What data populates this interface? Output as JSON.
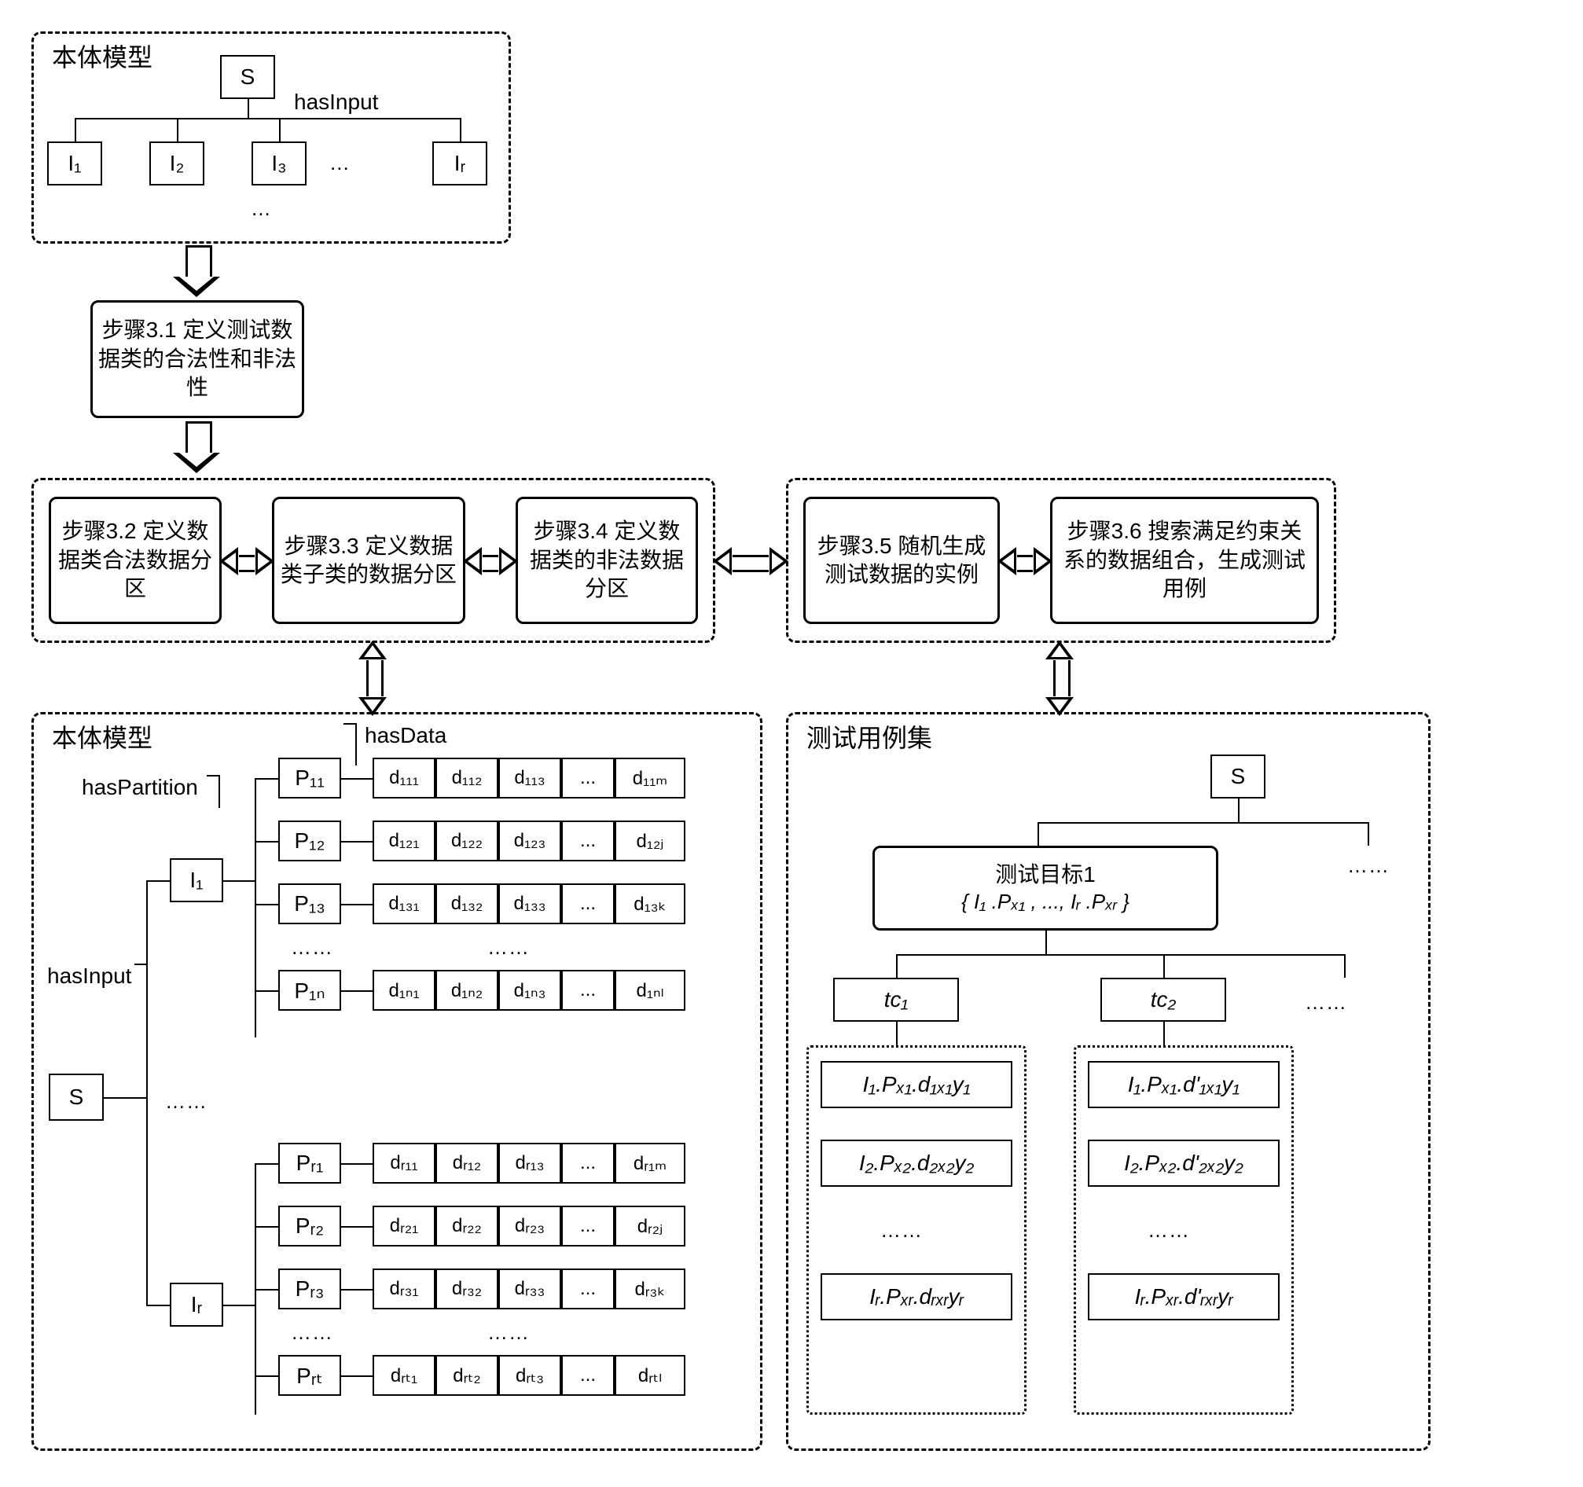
{
  "top_ontology": {
    "title": "本体模型",
    "root": "S",
    "hasInput": "hasInput",
    "children": [
      "I₁",
      "I₂",
      "I₃",
      "...",
      "Iᵣ"
    ],
    "bottom_ellipsis": "..."
  },
  "steps": {
    "s31": "步骤3.1 定义测试数据类的合法性和非法性",
    "s32": "步骤3.2 定义数据类合法数据分区",
    "s33": "步骤3.3 定义数据类子类的数据分区",
    "s34": "步骤3.4 定义数据类的非法数据分区",
    "s35": "步骤3.5 随机生成测试数据的实例",
    "s36": "步骤3.6 搜索满足约束关系的数据组合，生成测试用例"
  },
  "bottom_ontology": {
    "title": "本体模型",
    "root": "S",
    "hasInput": "hasInput",
    "inputs": [
      "I₁",
      "Iᵣ"
    ],
    "mid_ellipsis": "……",
    "hasPartition": "hasPartition",
    "hasData": "hasData",
    "partitions_I1": [
      "P₁₁",
      "P₁₂",
      "P₁₃",
      "P₁ₙ"
    ],
    "p_ellipsis_I1": "……",
    "partitions_Ir": [
      "Pᵣ₁",
      "Pᵣ₂",
      "Pᵣ₃",
      "Pᵣₜ"
    ],
    "p_ellipsis_Ir": "……",
    "rows": {
      "p11": [
        "d₁₁₁",
        "d₁₁₂",
        "d₁₁₃",
        "...",
        "d₁₁ₘ"
      ],
      "p12": [
        "d₁₂₁",
        "d₁₂₂",
        "d₁₂₃",
        "...",
        "d₁₂ⱼ"
      ],
      "p13": [
        "d₁₃₁",
        "d₁₃₂",
        "d₁₃₃",
        "...",
        "d₁₃ₖ"
      ],
      "p13_ell": "……",
      "p1n": [
        "d₁ₙ₁",
        "d₁ₙ₂",
        "d₁ₙ₃",
        "...",
        "d₁ₙₗ"
      ],
      "pr1": [
        "dᵣ₁₁",
        "dᵣ₁₂",
        "dᵣ₁₃",
        "...",
        "dᵣ₁ₘ"
      ],
      "pr2": [
        "dᵣ₂₁",
        "dᵣ₂₂",
        "dᵣ₂₃",
        "...",
        "dᵣ₂ⱼ"
      ],
      "pr3": [
        "dᵣ₃₁",
        "dᵣ₃₂",
        "dᵣ₃₃",
        "...",
        "dᵣ₃ₖ"
      ],
      "pr3_ell": "……",
      "prt": [
        "dᵣₜ₁",
        "dᵣₜ₂",
        "dᵣₜ₃",
        "...",
        "dᵣₜₗ"
      ]
    }
  },
  "testcases": {
    "title": "测试用例集",
    "root": "S",
    "target_title": "测试目标1",
    "target_set": "{ I₁ .Pₓ₁ , ..., Iᵣ .Pₓᵣ }",
    "top_ellipsis": "……",
    "tc1": "tc₁",
    "tc2": "tc₂",
    "tc_ellipsis": "……",
    "group1": [
      "I₁.Pₓ₁.d₁ₓ₁y₁",
      "I₂.Pₓ₂.d₂ₓ₂y₂",
      "……",
      "Iᵣ.Pₓᵣ.dᵣₓᵣyᵣ"
    ],
    "group2": [
      "I₁.Pₓ₁.d'₁ₓ₁y₁",
      "I₂.Pₓ₂.d'₂ₓ₂y₂",
      "……",
      "Iᵣ.Pₓᵣ.d'ᵣₓᵣyᵣ"
    ]
  },
  "chart_data": {
    "type": "flow_diagram",
    "title": "Ontology-driven test data partitioning and test case generation",
    "nodes": [
      {
        "id": "ontology_top",
        "label": "本体模型",
        "children": [
          "S"
        ],
        "S_children": [
          "I₁",
          "I₂",
          "I₃",
          "...",
          "Iᵣ"
        ],
        "edge_label": "hasInput"
      },
      {
        "id": "step31",
        "label": "步骤3.1 定义测试数据类的合法性和非法性"
      },
      {
        "id": "step32",
        "label": "步骤3.2 定义数据类合法数据分区"
      },
      {
        "id": "step33",
        "label": "步骤3.3 定义数据类子类的数据分区"
      },
      {
        "id": "step34",
        "label": "步骤3.4 定义数据类的非法数据分区"
      },
      {
        "id": "step35",
        "label": "步骤3.5 随机生成测试数据的实例"
      },
      {
        "id": "step36",
        "label": "步骤3.6 搜索满足约束关系的数据组合，生成测试用例"
      },
      {
        "id": "ontology_bottom",
        "label": "本体模型",
        "relations": [
          "hasInput",
          "hasPartition",
          "hasData"
        ]
      },
      {
        "id": "testcase_set",
        "label": "测试用例集",
        "root": "S",
        "target": "测试目标1 {I₁.Pₓ₁,...,Iᵣ.Pₓᵣ}",
        "cases": [
          "tc₁",
          "tc₂",
          "…"
        ]
      }
    ],
    "edges": [
      {
        "from": "ontology_top",
        "to": "step31",
        "type": "hollow_arrow_down"
      },
      {
        "from": "step31",
        "to": "step_group_left",
        "type": "hollow_arrow_down"
      },
      {
        "from": "step32",
        "to": "step33",
        "type": "double_arrow"
      },
      {
        "from": "step33",
        "to": "step34",
        "type": "double_arrow"
      },
      {
        "from": "step_group_left",
        "to": "step_group_right",
        "type": "double_arrow"
      },
      {
        "from": "step35",
        "to": "step36",
        "type": "double_arrow"
      },
      {
        "from": "step_group_left",
        "to": "ontology_bottom",
        "type": "double_arrow_v"
      },
      {
        "from": "step_group_right",
        "to": "testcase_set",
        "type": "double_arrow_v"
      }
    ]
  }
}
